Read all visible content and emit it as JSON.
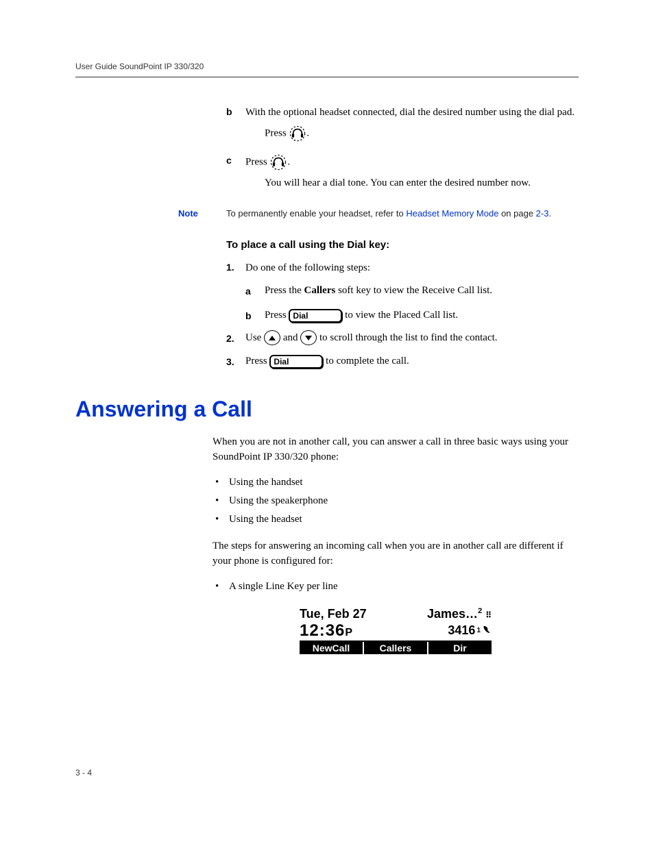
{
  "header": "User Guide SoundPoint IP 330/320",
  "step_b": {
    "letter": "b",
    "text1": "With the optional headset connected, dial the desired number using the dial pad.",
    "press": "Press ",
    "period": "."
  },
  "step_c": {
    "letter": "c",
    "press": "Press ",
    "period": ".",
    "text2": "You will hear a dial tone. You can enter the desired number now."
  },
  "note": {
    "label": "Note",
    "before": "To permanently enable your headset, refer to ",
    "link": "Headset Memory Mode",
    "mid": " on page ",
    "page": "2-3",
    "after": "."
  },
  "subhead": "To place a call using the Dial key:",
  "s1": {
    "num": "1.",
    "text": "Do one of the following steps:"
  },
  "s1a": {
    "letter": "a",
    "before": "Press the ",
    "bold": "Callers",
    "after": " soft key to view the Receive Call list."
  },
  "s1b": {
    "letter": "b",
    "before": "Press ",
    "after": " to view the Placed Call list."
  },
  "s2": {
    "num": "2.",
    "before": "Use ",
    "mid": " and ",
    "after": " to scroll through the list to find the contact."
  },
  "s3": {
    "num": "3.",
    "before": "Press ",
    "after": " to complete the call."
  },
  "dial_label": "Dial",
  "section_title": "Answering a Call",
  "para1": "When you are not in another call, you can answer a call in three basic ways using your SoundPoint IP 330/320 phone:",
  "bullets": [
    "Using the handset",
    "Using the speakerphone",
    "Using the headset"
  ],
  "para2": "The steps for answering an incoming call when you are in another call are different if your phone is configured for:",
  "bullets2": [
    "A single Line Key per line"
  ],
  "display": {
    "date": "Tue, Feb 27",
    "name": "James…",
    "name_badge": "2",
    "time": "12:36",
    "ampm": "P",
    "ext": "3416",
    "ext_badge": "1",
    "keys": [
      "NewCall",
      "Callers",
      "Dir"
    ]
  },
  "footer": "3 - 4"
}
